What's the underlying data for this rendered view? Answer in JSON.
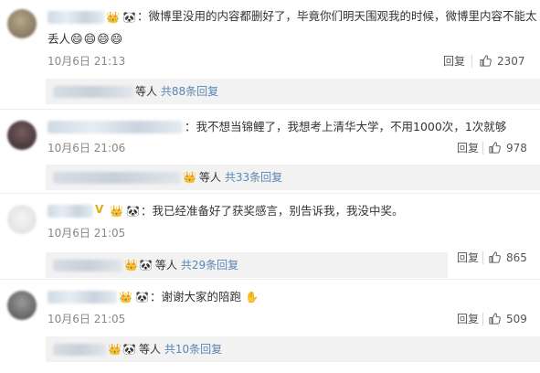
{
  "comments": [
    {
      "text_line1": "：微博里没用的内容都删好了，毕竟你们明天围观我的时候，微博里内容不能太",
      "text_line2": "丢人",
      "emojis": "😄😄😄😄",
      "timestamp": "10月6日 21:13",
      "reply_label": "回复",
      "likes": "2307",
      "replies_suffix": "等人",
      "replies_link": "共88条回复"
    },
    {
      "text_line1": "：我不想当锦鲤了，我想考上清华大学，不用1000次，1次就够",
      "timestamp": "10月6日 21:06",
      "reply_label": "回复",
      "likes": "978",
      "replies_suffix": "等人",
      "replies_link": "共33条回复"
    },
    {
      "text_line1": "：我已经准备好了获奖感言，别告诉我，我没中奖。",
      "timestamp": "10月6日 21:05",
      "reply_label": "回复",
      "likes": "865",
      "replies_suffix": "等人",
      "replies_link": "共29条回复"
    },
    {
      "text_line1": "：谢谢大家的陪跑",
      "timestamp": "10月6日 21:05",
      "reply_label": "回复",
      "likes": "509",
      "replies_suffix": "等人",
      "replies_link": "共10条回复"
    }
  ],
  "colors": {
    "link": "#5b86b5",
    "reply_bg": "#f2f2f2",
    "meta": "#888888"
  }
}
